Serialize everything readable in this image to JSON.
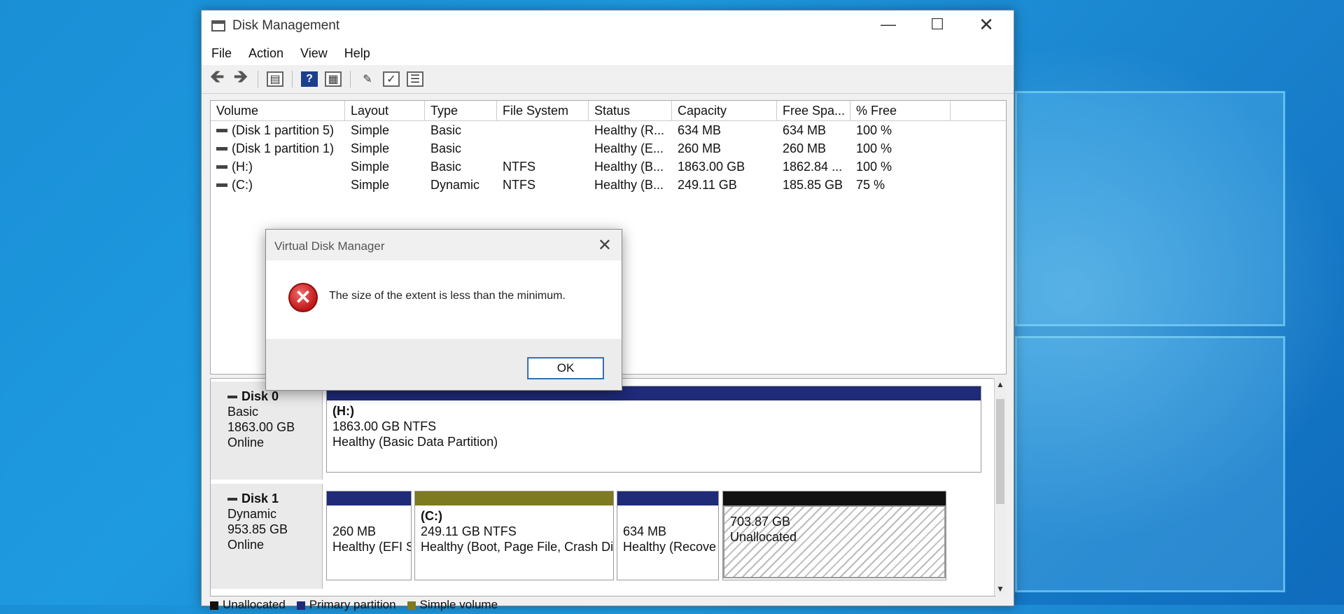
{
  "window": {
    "title": "Disk Management",
    "controls": {
      "minimize": "—",
      "maximize": "☐",
      "close": "✕"
    }
  },
  "menu": [
    "File",
    "Action",
    "View",
    "Help"
  ],
  "toolbar_icons": [
    "back-arrow-icon",
    "forward-arrow-icon",
    "console-tree-icon",
    "help-icon",
    "properties-icon",
    "connect-icon",
    "checklist-icon",
    "view-icon"
  ],
  "volume_list": {
    "columns": [
      "Volume",
      "Layout",
      "Type",
      "File System",
      "Status",
      "Capacity",
      "Free Spa...",
      "% Free"
    ],
    "rows": [
      [
        "(Disk 1 partition 5)",
        "Simple",
        "Basic",
        "",
        "Healthy (R...",
        "634 MB",
        "634 MB",
        "100 %"
      ],
      [
        "(Disk 1 partition 1)",
        "Simple",
        "Basic",
        "",
        "Healthy (E...",
        "260 MB",
        "260 MB",
        "100 %"
      ],
      [
        "(H:)",
        "Simple",
        "Basic",
        "NTFS",
        "Healthy (B...",
        "1863.00 GB",
        "1862.84 ...",
        "100 %"
      ],
      [
        "(C:)",
        "Simple",
        "Dynamic",
        "NTFS",
        "Healthy (B...",
        "249.11 GB",
        "185.85 GB",
        "75 %"
      ]
    ]
  },
  "disks": [
    {
      "name": "Disk 0",
      "type": "Basic",
      "size": "1863.00 GB",
      "state": "Online",
      "partitions": [
        {
          "label": "(H:)",
          "size": "1863.00 GB NTFS",
          "status": "Healthy (Basic Data Partition)"
        }
      ]
    },
    {
      "name": "Disk 1",
      "type": "Dynamic",
      "size": "953.85 GB",
      "state": "Online",
      "partitions": [
        {
          "label": "",
          "size": "260 MB",
          "status": "Healthy (EFI S"
        },
        {
          "label": "(C:)",
          "size": "249.11 GB NTFS",
          "status": "Healthy (Boot, Page File, Crash Di"
        },
        {
          "label": "",
          "size": "634 MB",
          "status": "Healthy (Recove"
        },
        {
          "label": "",
          "size": "703.87 GB",
          "status": "Unallocated"
        }
      ]
    }
  ],
  "legend": [
    {
      "label": "Unallocated",
      "color": "#111111"
    },
    {
      "label": "Primary partition",
      "color": "#1f2a78"
    },
    {
      "label": "Simple volume",
      "color": "#7d7a20"
    }
  ],
  "dialog": {
    "title": "Virtual Disk Manager",
    "close": "✕",
    "icon": "error-icon",
    "message": "The size of the extent is less than the minimum.",
    "ok_label": "OK"
  }
}
